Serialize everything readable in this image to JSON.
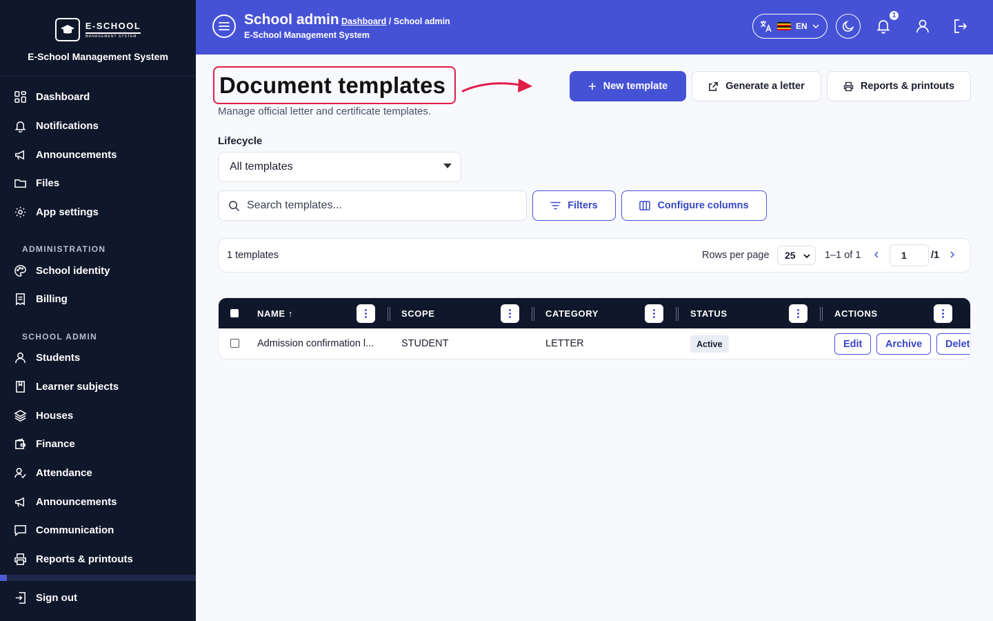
{
  "brand": {
    "logo_name": "E-SCHOOL",
    "logo_sub": "MANAGEMENT SYSTEM",
    "title": "E-School Management System"
  },
  "sidebar": {
    "main_items": [
      {
        "label": "Dashboard",
        "icon": "dashboard-icon"
      },
      {
        "label": "Notifications",
        "icon": "bell-icon"
      },
      {
        "label": "Announcements",
        "icon": "megaphone-icon"
      },
      {
        "label": "Files",
        "icon": "folder-icon"
      },
      {
        "label": "App settings",
        "icon": "gear-icon"
      }
    ],
    "section_admin": "ADMINISTRATION",
    "admin_items": [
      {
        "label": "School identity",
        "icon": "palette-icon"
      },
      {
        "label": "Billing",
        "icon": "receipt-icon"
      }
    ],
    "section_school": "SCHOOL ADMIN",
    "school_items": [
      {
        "label": "Students",
        "icon": "user-icon"
      },
      {
        "label": "Learner subjects",
        "icon": "book-icon"
      },
      {
        "label": "Houses",
        "icon": "layers-icon"
      },
      {
        "label": "Finance",
        "icon": "wallet-icon"
      },
      {
        "label": "Attendance",
        "icon": "user-check-icon"
      },
      {
        "label": "Announcements",
        "icon": "megaphone-icon"
      },
      {
        "label": "Communication",
        "icon": "message-icon"
      },
      {
        "label": "Reports & printouts",
        "icon": "printer-icon"
      }
    ],
    "sign_out": "Sign out"
  },
  "header": {
    "title": "School admin",
    "breadcrumb_link": "Dashboard",
    "breadcrumb_current": "/ School admin",
    "subtitle": "E-School Management System",
    "language": "EN",
    "notification_count": "1"
  },
  "page": {
    "title": "Document templates",
    "subtitle": "Manage official letter and certificate templates.",
    "new_template": "New template",
    "generate_letter": "Generate a letter",
    "reports": "Reports & printouts",
    "lifecycle_label": "Lifecycle",
    "lifecycle_value": "All templates",
    "search_placeholder": "Search templates...",
    "filters": "Filters",
    "configure_columns": "Configure columns"
  },
  "pager": {
    "count": "1 templates",
    "rows_per_page_label": "Rows per page",
    "rows_per_page": "25",
    "range": "1–1 of 1",
    "page": "1",
    "total_pages": "/1"
  },
  "table": {
    "columns": [
      "NAME ↑",
      "SCOPE",
      "CATEGORY",
      "STATUS",
      "ACTIONS"
    ],
    "rows": [
      {
        "name": "Admission confirmation l...",
        "scope": "STUDENT",
        "category": "LETTER",
        "status": "Active",
        "actions": [
          "Edit",
          "Archive",
          "Delete"
        ]
      }
    ]
  },
  "colors": {
    "primary": "#4652d6",
    "sidebar": "#0f172a",
    "highlight": "#e11d48"
  }
}
